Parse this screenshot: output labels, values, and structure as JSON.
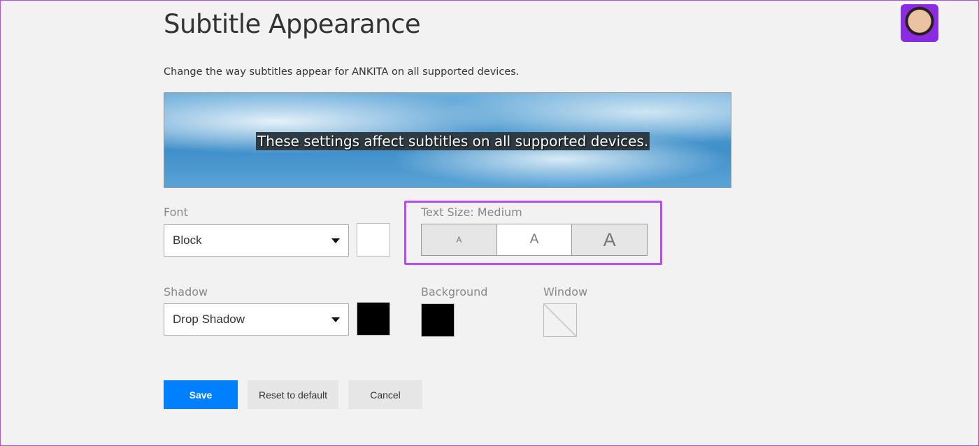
{
  "title": "Subtitle Appearance",
  "description": "Change the way subtitles appear for ANKITA on all supported devices.",
  "preview_text": "These settings affect subtitles on all supported devices.",
  "font": {
    "label": "Font",
    "value": "Block",
    "color": "#ffffff"
  },
  "text_size": {
    "label": "Text Size: Medium",
    "options": [
      "A",
      "A",
      "A"
    ],
    "selected": "Medium"
  },
  "shadow": {
    "label": "Shadow",
    "value": "Drop Shadow",
    "color": "#000000"
  },
  "background": {
    "label": "Background",
    "color": "#000000"
  },
  "window": {
    "label": "Window",
    "color": "none"
  },
  "buttons": {
    "save": "Save",
    "reset": "Reset to default",
    "cancel": "Cancel"
  },
  "colors": {
    "accent": "#0080ff",
    "highlight": "#b94cf0"
  }
}
